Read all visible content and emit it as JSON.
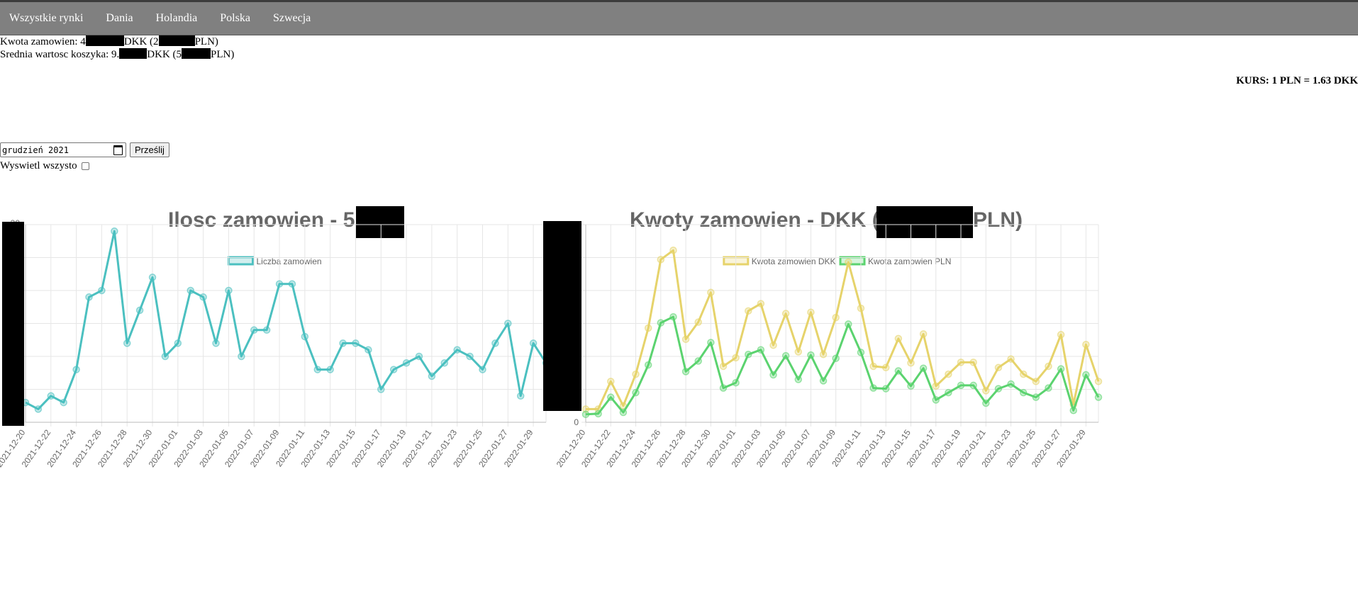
{
  "nav": {
    "items": [
      "Wszystkie rynki",
      "Dania",
      "Holandia",
      "Polska",
      "Szwecja"
    ]
  },
  "stats": {
    "kwota_prefix": "Kwota zamowien: 4",
    "kwota_mid": "DKK (2",
    "kwota_suffix": "PLN)",
    "srednia_prefix": "Srednia wartosc koszyka: 9.",
    "srednia_mid": "DKK (5",
    "srednia_suffix": "PLN)"
  },
  "kurs": "KURS: 1 PLN = 1.63 DKK",
  "form": {
    "month_value": "grudzień 2021",
    "submit_label": "Prześlij",
    "show_all_label": "Wyswietl wszysto",
    "show_all_checked": false
  },
  "colors": {
    "teal": "#4bc0c0",
    "yellow": "#e6d36b",
    "green": "#5bd36f",
    "grid": "#e6e6e6",
    "text": "#666666"
  },
  "chart_data": [
    {
      "type": "line",
      "title_prefix": "Ilosc zamowien - 5",
      "x": [
        "2021-12-20",
        "2021-12-21",
        "2021-12-22",
        "2021-12-23",
        "2021-12-24",
        "2021-12-25",
        "2021-12-26",
        "2021-12-27",
        "2021-12-28",
        "2021-12-29",
        "2021-12-30",
        "2021-12-31",
        "2022-01-01",
        "2022-01-02",
        "2022-01-03",
        "2022-01-04",
        "2022-01-05",
        "2022-01-06",
        "2022-01-07",
        "2022-01-08",
        "2022-01-09",
        "2022-01-10",
        "2022-01-11",
        "2022-01-12",
        "2022-01-13",
        "2022-01-14",
        "2022-01-15",
        "2022-01-16",
        "2022-01-17",
        "2022-01-18",
        "2022-01-19",
        "2022-01-20",
        "2022-01-21",
        "2022-01-22",
        "2022-01-23",
        "2022-01-24",
        "2022-01-25",
        "2022-01-26",
        "2022-01-27",
        "2022-01-28",
        "2022-01-29",
        "2022-01-30"
      ],
      "tick_labels": [
        "2021-12-20",
        "2021-12-22",
        "2021-12-24",
        "2021-12-26",
        "2021-12-28",
        "2021-12-30",
        "2022-01-01",
        "2022-01-03",
        "2022-01-05",
        "2022-01-07",
        "2022-01-09",
        "2022-01-11",
        "2022-01-13",
        "2022-01-15",
        "2022-01-17",
        "2022-01-19",
        "2022-01-21",
        "2022-01-23",
        "2022-01-25",
        "2022-01-27",
        "2022-01-29"
      ],
      "y_top_label": "30",
      "ylim": [
        0,
        30
      ],
      "series": [
        {
          "name": "Liczba zamowien",
          "color": "#4bc0c0",
          "values": [
            3,
            2,
            4,
            3,
            8,
            19,
            20,
            29,
            12,
            17,
            22,
            10,
            12,
            20,
            19,
            12,
            20,
            10,
            14,
            14,
            21,
            21,
            13,
            8,
            8,
            12,
            12,
            11,
            5,
            8,
            9,
            10,
            7,
            9,
            11,
            10,
            8,
            12,
            15,
            4,
            12,
            9
          ]
        }
      ],
      "grid": true
    },
    {
      "type": "line",
      "title_prefix": "Kwoty zamowien - DKK (",
      "title_suffix": "PLN)",
      "x": [
        "2021-12-20",
        "2021-12-21",
        "2021-12-22",
        "2021-12-23",
        "2021-12-24",
        "2021-12-25",
        "2021-12-26",
        "2021-12-27",
        "2021-12-28",
        "2021-12-29",
        "2021-12-30",
        "2021-12-31",
        "2022-01-01",
        "2022-01-02",
        "2022-01-03",
        "2022-01-04",
        "2022-01-05",
        "2022-01-06",
        "2022-01-07",
        "2022-01-08",
        "2022-01-09",
        "2022-01-10",
        "2022-01-11",
        "2022-01-12",
        "2022-01-13",
        "2022-01-14",
        "2022-01-15",
        "2022-01-16",
        "2022-01-17",
        "2022-01-18",
        "2022-01-19",
        "2022-01-20",
        "2022-01-21",
        "2022-01-22",
        "2022-01-23",
        "2022-01-24",
        "2022-01-25",
        "2022-01-26",
        "2022-01-27",
        "2022-01-28",
        "2022-01-29",
        "2022-01-30"
      ],
      "tick_labels": [
        "2021-12-20",
        "2021-12-22",
        "2021-12-24",
        "2021-12-26",
        "2021-12-28",
        "2021-12-30",
        "2022-01-01",
        "2022-01-03",
        "2022-01-05",
        "2022-01-07",
        "2022-01-09",
        "2022-01-11",
        "2022-01-13",
        "2022-01-15",
        "2022-01-17",
        "2022-01-19",
        "2022-01-21",
        "2022-01-23",
        "2022-01-25",
        "2022-01-27",
        "2022-01-29"
      ],
      "y_zero_label": "0",
      "ylim": [
        0,
        30
      ],
      "series": [
        {
          "name": "Kwota zamowien DKK",
          "color": "#e6d36b",
          "values": [
            2,
            2,
            6.2,
            2.5,
            7.3,
            14.3,
            24.7,
            26.1,
            12.6,
            15.2,
            19.7,
            8.5,
            9.8,
            16.9,
            18.0,
            11.7,
            16.5,
            10.7,
            16.7,
            10.3,
            15.9,
            24.3,
            17.3,
            8.5,
            8.3,
            12.7,
            9.0,
            13.4,
            5.5,
            7.3,
            9.1,
            9.1,
            4.8,
            8.3,
            9.6,
            7.3,
            6.2,
            8.5,
            13.3,
            2.7,
            11.8,
            6.2
          ]
        },
        {
          "name": "Kwota zamowien PLN",
          "color": "#5bd36f",
          "values": [
            1.2,
            1.3,
            3.8,
            1.5,
            4.5,
            8.7,
            15.1,
            16.0,
            7.7,
            9.3,
            12.1,
            5.2,
            6.0,
            10.3,
            11.0,
            7.2,
            10.1,
            6.5,
            10.2,
            6.3,
            9.7,
            14.9,
            10.6,
            5.2,
            5.1,
            7.8,
            5.5,
            8.2,
            3.4,
            4.5,
            5.6,
            5.6,
            2.9,
            5.1,
            5.8,
            4.5,
            3.8,
            5.2,
            8.1,
            1.8,
            7.2,
            3.8
          ]
        }
      ],
      "grid": true
    }
  ]
}
